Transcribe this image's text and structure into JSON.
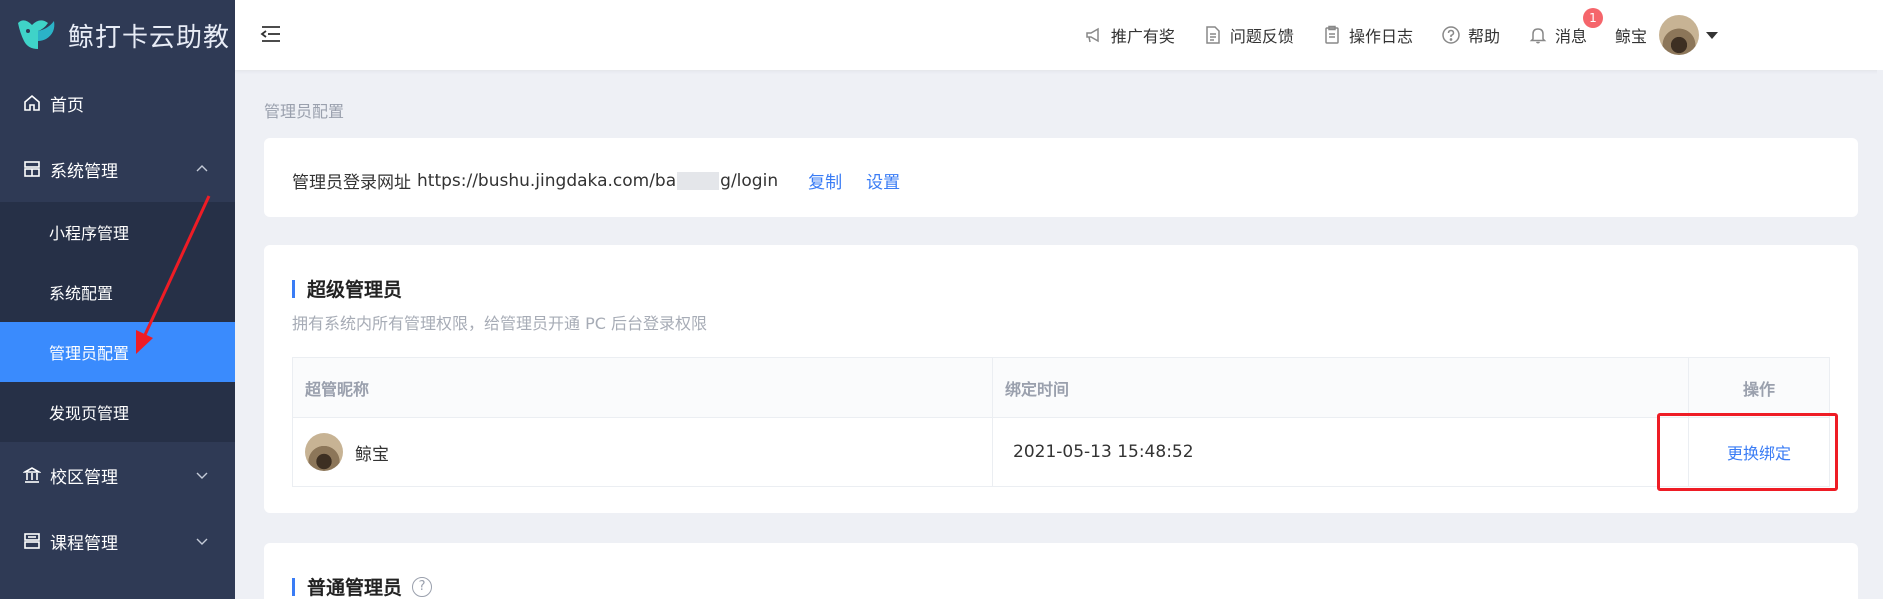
{
  "app": {
    "title": "鲸打卡云助教"
  },
  "sidebar": {
    "items": [
      {
        "label": "首页",
        "icon": "home-icon"
      },
      {
        "label": "系统管理",
        "icon": "system-icon",
        "expanded": true,
        "children": [
          {
            "label": "小程序管理"
          },
          {
            "label": "系统配置"
          },
          {
            "label": "管理员配置",
            "active": true
          },
          {
            "label": "发现页管理"
          }
        ]
      },
      {
        "label": "校区管理",
        "icon": "campus-icon"
      },
      {
        "label": "课程管理",
        "icon": "course-icon"
      }
    ]
  },
  "header": {
    "promote": "推广有奖",
    "feedback": "问题反馈",
    "log": "操作日志",
    "help": "帮助",
    "messages": "消息",
    "message_count": "1",
    "username": "鲸宝"
  },
  "breadcrumb": "管理员配置",
  "login_url": {
    "label": "管理员登录网址",
    "url_prefix": "https://bushu.jingdaka.com/ba",
    "url_suffix": "g/login",
    "copy": "复制",
    "settings": "设置"
  },
  "super_admin": {
    "title": "超级管理员",
    "desc": "拥有系统内所有管理权限，给管理员开通 PC 后台登录权限",
    "columns": [
      "超管昵称",
      "绑定时间",
      "操作"
    ],
    "rows": [
      {
        "name": "鲸宝",
        "bind_time": "2021-05-13 15:48:52",
        "action": "更换绑定"
      }
    ]
  },
  "normal_admin": {
    "title": "普通管理员",
    "help_icon": "?"
  },
  "colors": {
    "sidebar": "#2f3a55",
    "active": "#3a8bfd",
    "link": "#3a7cf5",
    "annotation": "#ee1c25"
  }
}
